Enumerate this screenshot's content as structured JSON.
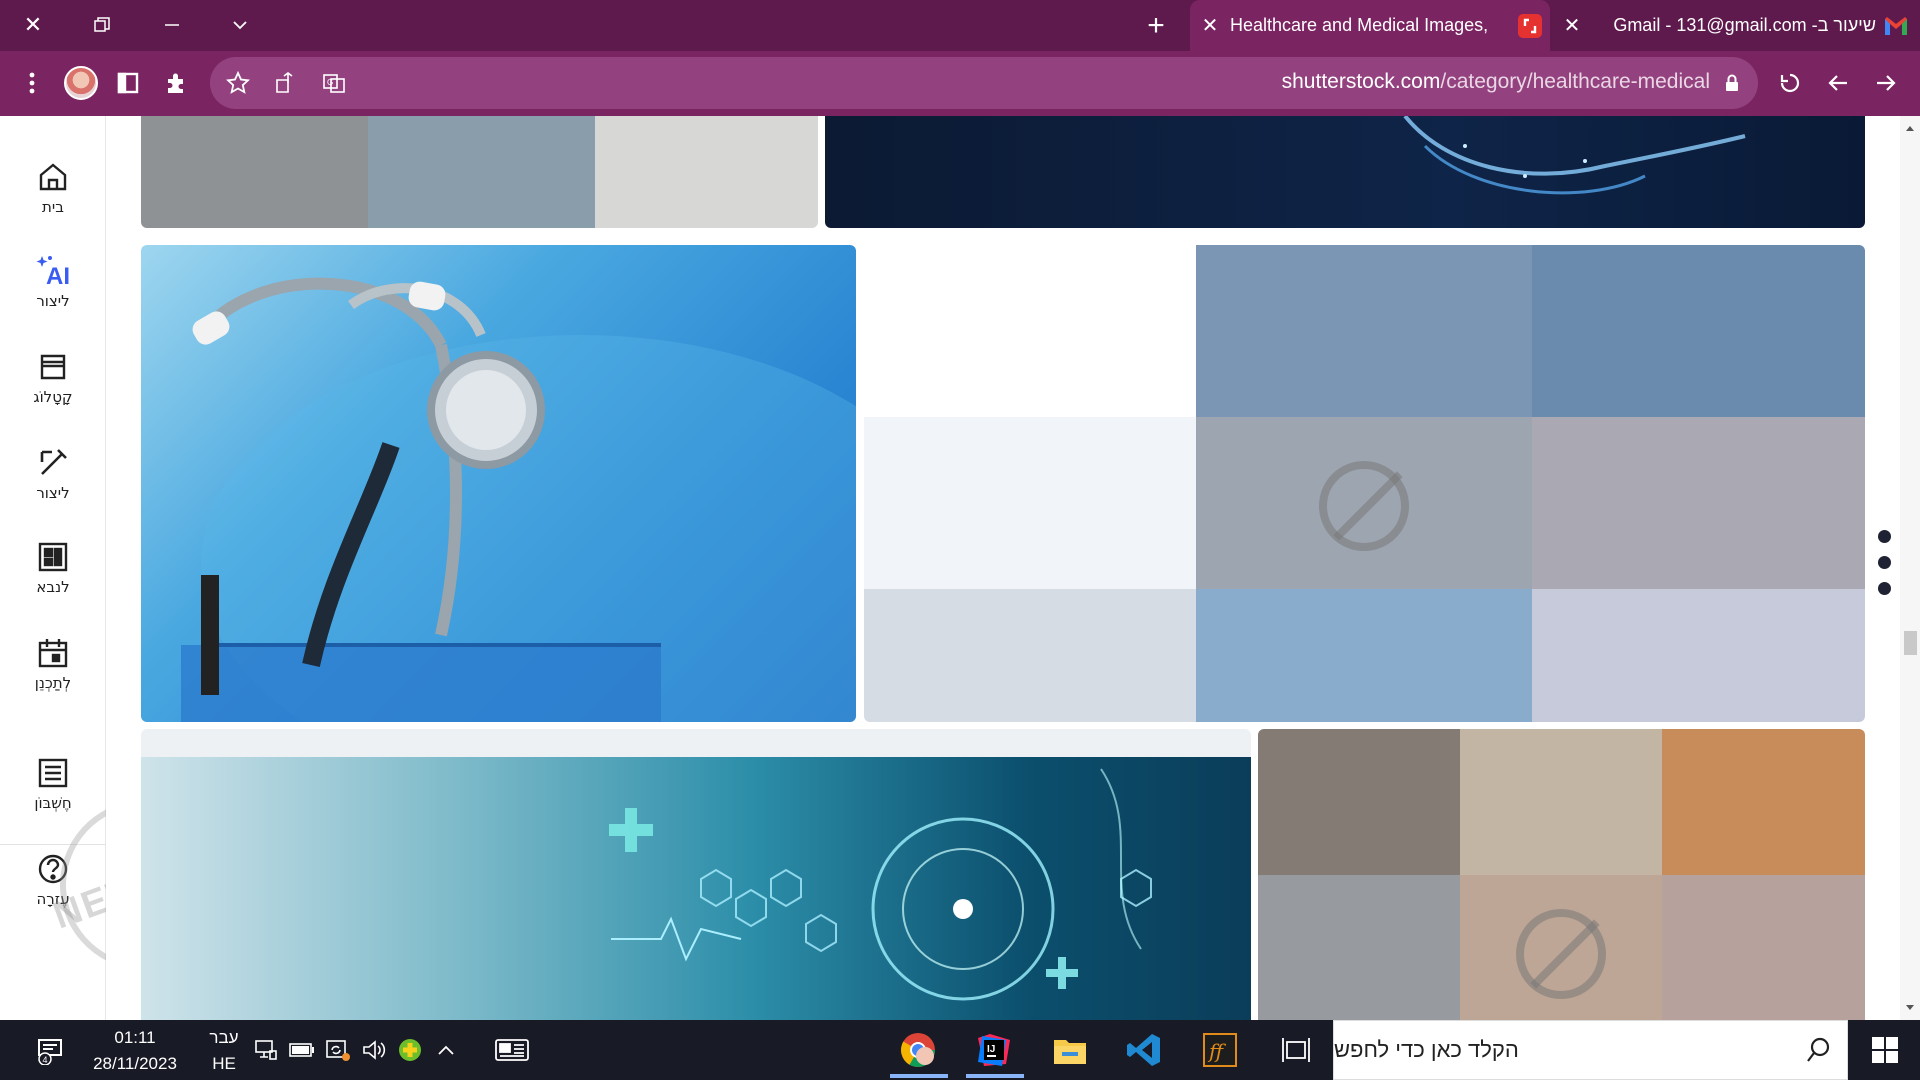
{
  "browser": {
    "tabs": [
      {
        "title": "Healthcare and Medical Images,",
        "active": true
      },
      {
        "title": "שיעור ב- Gmail - 131@gmail.com",
        "active": false
      }
    ],
    "url_host": "shutterstock.com",
    "url_path": "/category/healthcare-medical"
  },
  "nav": {
    "items": [
      {
        "label": "בית",
        "icon": "home-icon"
      },
      {
        "label": "ליצור",
        "icon": "ai-sparkle-icon"
      },
      {
        "label": "קָטָלוֹג",
        "icon": "catalog-icon"
      },
      {
        "label": "ליצור",
        "icon": "edit-icon"
      },
      {
        "label": "לנבא",
        "icon": "dashboard-icon"
      },
      {
        "label": "לְתַכְנֵן",
        "icon": "calendar-icon"
      },
      {
        "label": "חֶשְׁבּוֹן",
        "icon": "account-list-icon"
      },
      {
        "label": "עֶזרָה",
        "icon": "help-icon"
      }
    ]
  },
  "taskbar": {
    "search_placeholder": "הקלד כאן כדי לחפש",
    "time": "01:11",
    "date": "28/11/2023",
    "lang_top": "עבר",
    "lang_bottom": "HE",
    "notification_count": "4"
  },
  "colors": {
    "titlebar": "#5f1a4d",
    "toolbar": "#7b2462",
    "taskbar": "#181a25"
  }
}
